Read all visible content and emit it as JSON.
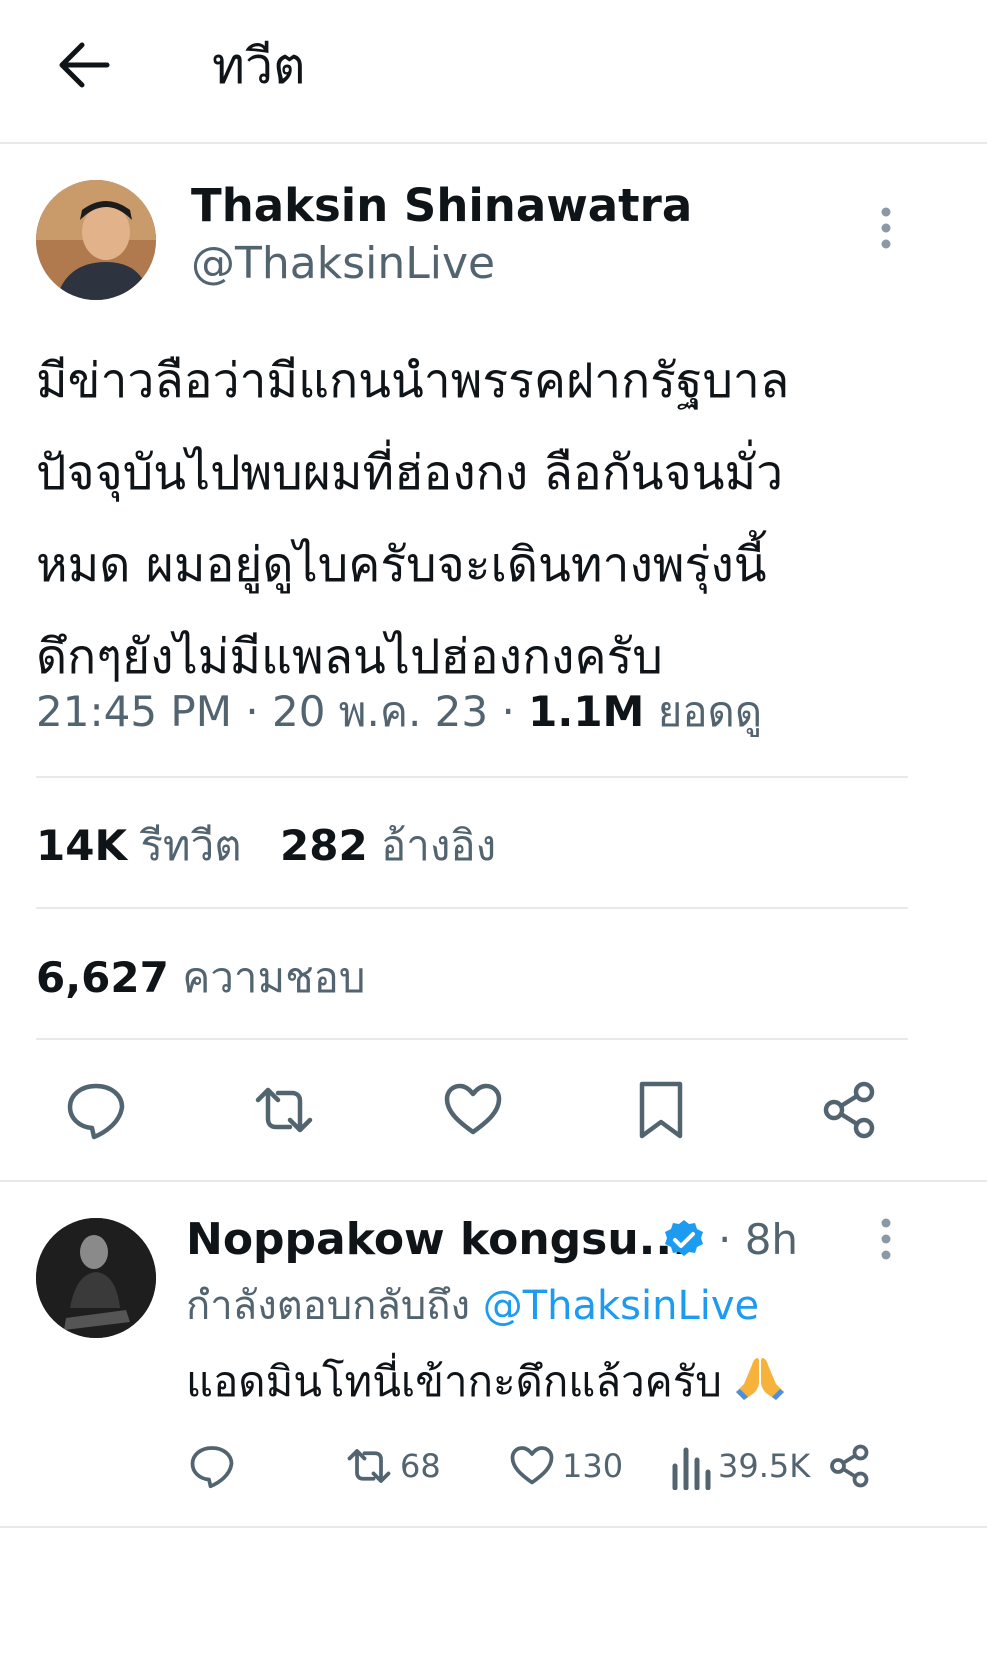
{
  "header": {
    "title": "ทวีต"
  },
  "tweet": {
    "author_name": "Thaksin Shinawatra",
    "author_handle": "@ThaksinLive",
    "text_lines": [
      "มีข่าวลือว่ามีแกนนำพรรคฝากรัฐบาล",
      "ปัจจุบันไปพบผมที่ฮ่องกง ลือกันจนมั่ว",
      "หมด ผมอยู่ดูไบครับจะเดินทางพรุ่งนี้",
      "ดึกๆยังไม่มีแพลนไปฮ่องกงครับ"
    ],
    "time": "21:45 PM",
    "date": "20 พ.ค. 23",
    "views_count": "1.1M",
    "views_label": "ยอดดู",
    "retweets_count": "14K",
    "retweets_label": "รีทวีต",
    "quotes_count": "282",
    "quotes_label": "อ้างอิง",
    "likes_count": "6,627",
    "likes_label": "ความชอบ"
  },
  "actions": [
    "reply-icon",
    "retweet-icon",
    "like-icon",
    "bookmark-icon",
    "share-icon"
  ],
  "reply": {
    "author_name": "Noppakow kongsu...",
    "time": "· 8h",
    "replying_prefix": "กำลังตอบกลับถึง",
    "replying_handle": "@ThaksinLive",
    "text": "แอดมินโทนี่เข้ากะดึกแล้วครับ",
    "emoji": "folded-hands-emoji",
    "retweets": "68",
    "likes": "130",
    "views": "39.5K"
  },
  "colors": {
    "text": "#0f1419",
    "muted": "#536471",
    "link": "#1d9bf0",
    "divider": "#e7e9ea",
    "verified": "#1d9bf0"
  }
}
